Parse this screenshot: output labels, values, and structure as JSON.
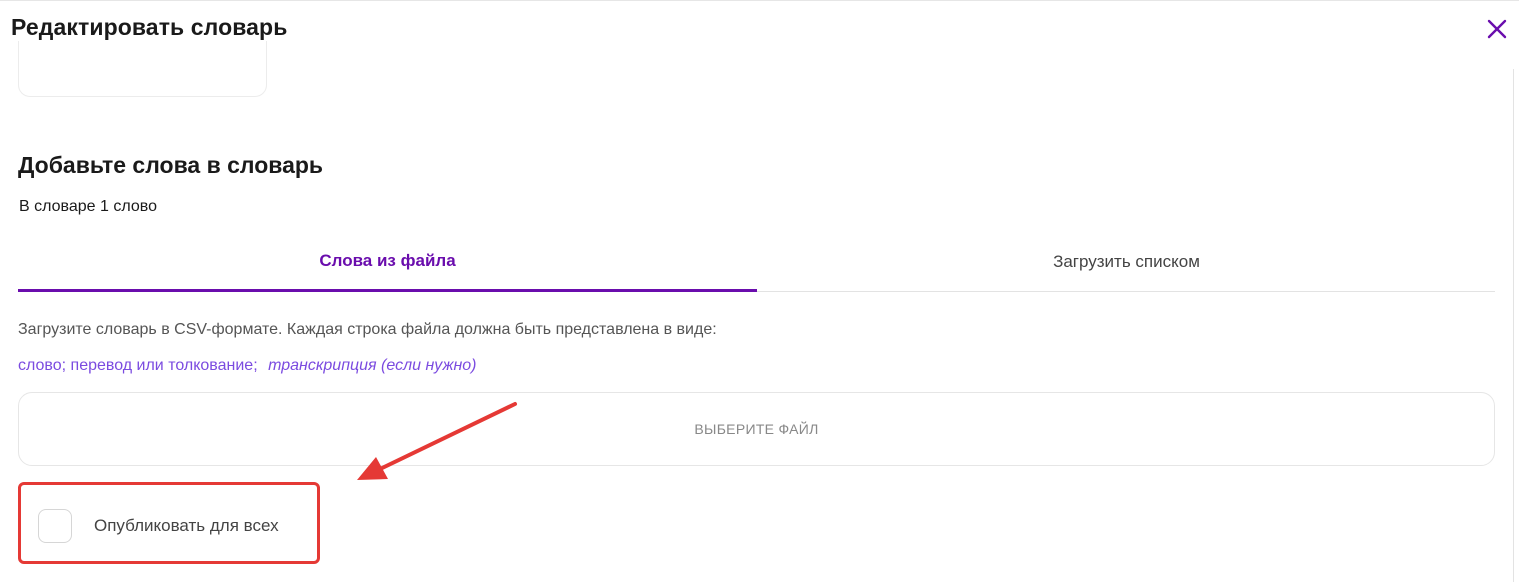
{
  "modal": {
    "title": "Редактировать словарь",
    "close_icon": "close-icon"
  },
  "section": {
    "heading": "Добавьте слова в словарь",
    "word_count": "В словаре 1 слово"
  },
  "tabs": [
    {
      "label": "Слова из файла",
      "active": true
    },
    {
      "label": "Загрузить списком",
      "active": false
    }
  ],
  "upload": {
    "instructions": "Загрузите словарь в CSV-формате. Каждая строка файла должна быть представлена в виде:",
    "format_main": "слово; перевод или толкование;",
    "format_optional": "транскрипция (если нужно)",
    "file_button_label": "ВЫБЕРИТЕ ФАЙЛ"
  },
  "publish": {
    "label": "Опубликовать для всех",
    "checked": false
  },
  "colors": {
    "accent": "#6a0dad",
    "link": "#7b4be0",
    "highlight": "#e53935"
  }
}
